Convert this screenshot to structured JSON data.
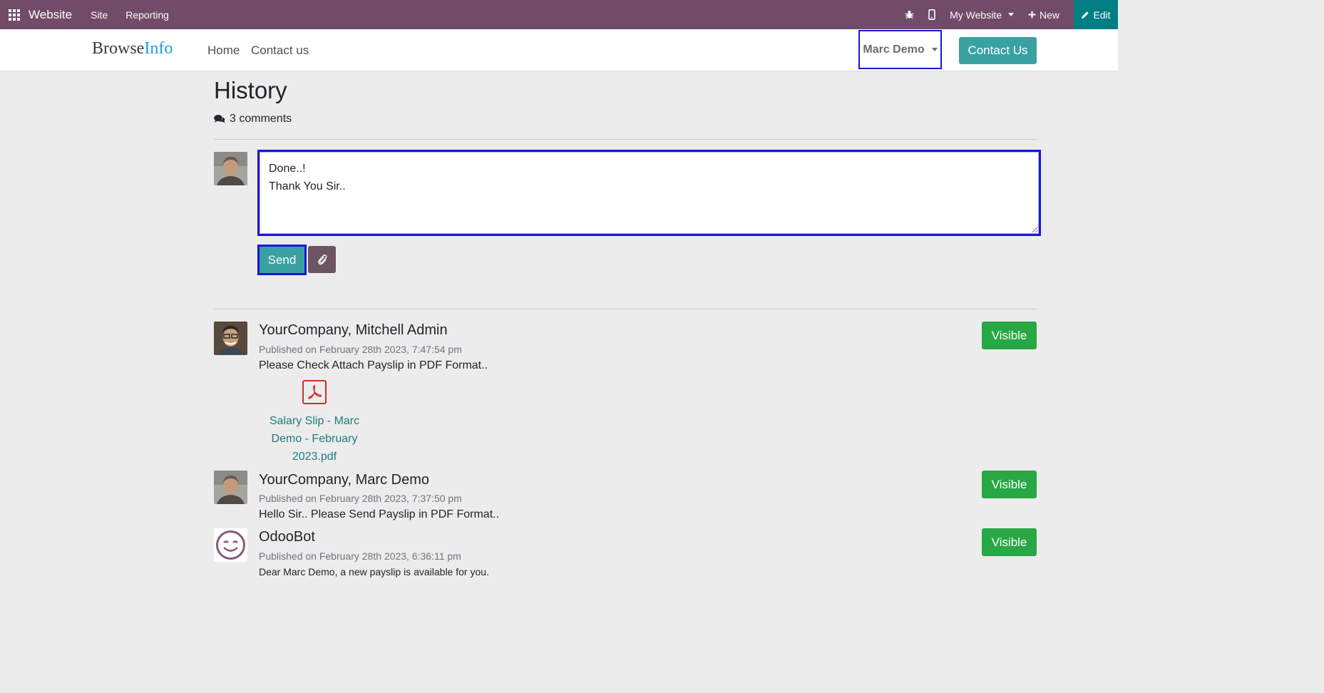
{
  "topbar": {
    "app_name": "Website",
    "menu": [
      "Site",
      "Reporting"
    ],
    "website_selector": "My Website",
    "new_label": "New",
    "edit_label": "Edit",
    "icons": [
      "apps-grid-icon",
      "bug-icon",
      "mobile-icon",
      "plus-icon",
      "pencil-icon"
    ]
  },
  "header": {
    "logo_part1": "Browse",
    "logo_part2": "Info",
    "nav": [
      "Home",
      "Contact us"
    ],
    "user_name": "Marc Demo",
    "contact_button": "Contact Us",
    "colors": {
      "logo_accent": "#1a9fd6",
      "contact_button": "#3aa1a3"
    }
  },
  "page": {
    "title": "History",
    "comments_count": "3 comments"
  },
  "composer": {
    "value": "Done..!\nThank You Sir..",
    "send_label": "Send",
    "attach_icon": "paperclip-icon"
  },
  "messages": [
    {
      "author": "YourCompany, Mitchell Admin",
      "date": "Published on February 28th 2023, 7:47:54 pm",
      "body": "Please Check Attach Payslip in PDF Format..",
      "visibility": "Visible",
      "attachment": {
        "icon": "pdf-icon",
        "name": "Salary Slip - Marc Demo - February 2023.pdf"
      }
    },
    {
      "author": "YourCompany, Marc Demo",
      "date": "Published on February 28th 2023, 7:37:50 pm",
      "body": "Hello Sir.. Please Send Payslip in PDF Format..",
      "visibility": "Visible"
    },
    {
      "author": "OdooBot",
      "date": "Published on February 28th 2023, 6:36:11 pm",
      "body": "Dear Marc Demo, a new payslip is available for you.",
      "visibility": "Visible"
    }
  ],
  "colors": {
    "topbar_bg": "#714b67",
    "edit_bg": "#017e84",
    "visible_button": "#28a745",
    "highlight_border": "#1a16d8"
  }
}
